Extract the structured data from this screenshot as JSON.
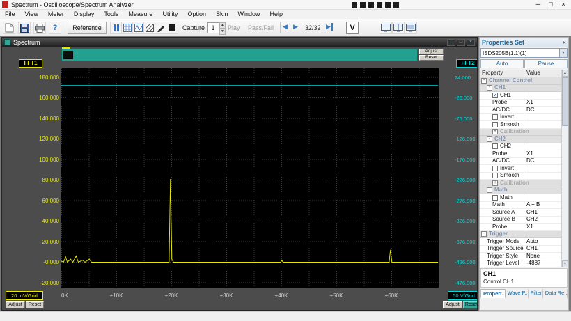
{
  "window": {
    "title": "Spectrum - Oscilloscope/Spectrum Analyzer"
  },
  "menu_items": [
    "File",
    "View",
    "Meter",
    "Display",
    "Tools",
    "Measure",
    "Utility",
    "Option",
    "Skin",
    "Window",
    "Help"
  ],
  "toolbar": {
    "reference": "Reference",
    "capture_label": "Capture",
    "capture_value": "1",
    "play": "Play",
    "pass_fail": "Pass/Fail",
    "counter": "32/32",
    "v_label": "V"
  },
  "icons": {
    "titlebar": [
      "app-icon",
      "minimize-icon",
      "maximize-icon",
      "close-icon"
    ],
    "toolbar": [
      "new-file-icon",
      "save-icon",
      "print-icon",
      "help-icon",
      "pause-icon",
      "grid-icon",
      "waveform-grid-icon",
      "hatch-icon",
      "pen-icon",
      "solid-square-icon",
      "prev-capture-icon",
      "next-capture-icon",
      "last-capture-icon",
      "v-icon",
      "display-single-icon",
      "display-dual-icon",
      "display-list-icon"
    ],
    "spectrum_window": [
      "window-icon",
      "minimize-icon",
      "restore-icon",
      "close-icon"
    ],
    "properties": [
      "close-icon",
      "dropdown-arrow-icon",
      "scroll-up-icon",
      "scroll-down-icon"
    ]
  },
  "spectrum": {
    "title": "Spectrum",
    "adjust": "Adjust",
    "reset": "Reset",
    "fft1": {
      "label": "FFT1",
      "unit": "20 mV/Grid",
      "ticks": [
        "180.000",
        "160.000",
        "140.000",
        "120.000",
        "100.000",
        "80.000",
        "60.000",
        "40.000",
        "20.000",
        "-0.000",
        "-20.000"
      ]
    },
    "fft2": {
      "label": "FFT2",
      "unit": "50 V/Grid",
      "ticks": [
        "24.000",
        "-26.000",
        "-76.000",
        "-126.000",
        "-176.000",
        "-226.000",
        "-276.000",
        "-326.000",
        "-376.000",
        "-426.000",
        "-476.000"
      ]
    },
    "x_ticks": [
      "0K",
      "+10K",
      "+20K",
      "+30K",
      "+40K",
      "+50K",
      "+60K"
    ]
  },
  "chart_data": {
    "type": "line",
    "title": "FFT Spectrum",
    "x_unit": "kHz",
    "x_range": [
      0,
      68.5
    ],
    "grid": {
      "x_step_khz": 5,
      "y_step_left": 20,
      "style": "dotted"
    },
    "left_axis": {
      "label": "FFT1",
      "ylim": [
        -20,
        180
      ],
      "unit": "20 mV/Grid",
      "color": "#e8e800"
    },
    "right_axis": {
      "label": "FFT2",
      "ylim": [
        -476,
        24
      ],
      "unit": "50 V/Grid",
      "color": "#00dcdc"
    },
    "series": [
      {
        "name": "FFT1",
        "axis": "left",
        "color": "#e8e800",
        "points": [
          [
            0,
            1
          ],
          [
            0.4,
            0
          ],
          [
            0.8,
            5
          ],
          [
            1.1,
            0
          ],
          [
            1.7,
            3
          ],
          [
            2.1,
            0
          ],
          [
            2.7,
            6
          ],
          [
            3.1,
            0
          ],
          [
            3.9,
            2
          ],
          [
            4.3,
            0
          ],
          [
            5.1,
            3
          ],
          [
            5.5,
            0
          ],
          [
            19.6,
            0
          ],
          [
            19.85,
            81
          ],
          [
            20.1,
            3
          ],
          [
            20.4,
            0
          ],
          [
            39.9,
            0
          ],
          [
            40.1,
            2
          ],
          [
            40.3,
            0
          ],
          [
            59.6,
            0
          ],
          [
            59.85,
            12
          ],
          [
            60.1,
            0
          ],
          [
            68.5,
            0
          ]
        ]
      },
      {
        "name": "FFT2",
        "axis": "right",
        "color": "#00dcdc",
        "points": [
          [
            0,
            4
          ],
          [
            68.5,
            4
          ]
        ]
      }
    ]
  },
  "properties": {
    "title": "Properties Set",
    "device": "ISDS205B(1.1)(1)",
    "auto": "Auto",
    "pause": "Pause",
    "columns": [
      "Property",
      "Value"
    ],
    "rows": [
      {
        "t": "group",
        "lv": 0,
        "label": "Channel Control",
        "exp": true
      },
      {
        "t": "group",
        "lv": 1,
        "label": "CH1",
        "exp": true
      },
      {
        "t": "check",
        "lv": 2,
        "label": "CH1",
        "checked": true
      },
      {
        "t": "prop",
        "lv": 2,
        "label": "Probe",
        "value": "X1"
      },
      {
        "t": "prop",
        "lv": 2,
        "label": "AC/DC",
        "value": "DC"
      },
      {
        "t": "check",
        "lv": 2,
        "label": "Invert",
        "checked": false
      },
      {
        "t": "check",
        "lv": 2,
        "label": "Smooth",
        "checked": false
      },
      {
        "t": "group",
        "lv": 2,
        "label": "Calibration",
        "exp": false,
        "dim": true
      },
      {
        "t": "group",
        "lv": 1,
        "label": "CH2",
        "exp": true
      },
      {
        "t": "check",
        "lv": 2,
        "label": "CH2",
        "checked": false
      },
      {
        "t": "prop",
        "lv": 2,
        "label": "Probe",
        "value": "X1"
      },
      {
        "t": "prop",
        "lv": 2,
        "label": "AC/DC",
        "value": "DC"
      },
      {
        "t": "check",
        "lv": 2,
        "label": "Invert",
        "checked": false
      },
      {
        "t": "check",
        "lv": 2,
        "label": "Smooth",
        "checked": false
      },
      {
        "t": "group",
        "lv": 2,
        "label": "Calibration",
        "exp": false,
        "dim": true
      },
      {
        "t": "group",
        "lv": 1,
        "label": "Math",
        "exp": true
      },
      {
        "t": "check",
        "lv": 2,
        "label": "Math",
        "checked": false
      },
      {
        "t": "prop",
        "lv": 2,
        "label": "Math",
        "value": "A + B"
      },
      {
        "t": "prop",
        "lv": 2,
        "label": "Source A",
        "value": "CH1"
      },
      {
        "t": "prop",
        "lv": 2,
        "label": "Source B",
        "value": "CH2"
      },
      {
        "t": "prop",
        "lv": 2,
        "label": "Probe",
        "value": "X1"
      },
      {
        "t": "group",
        "lv": 0,
        "label": "Trigger",
        "exp": true
      },
      {
        "t": "prop",
        "lv": 1,
        "label": "Trigger Mode",
        "value": "Auto"
      },
      {
        "t": "prop",
        "lv": 1,
        "label": "Trigger Source",
        "value": "CH1"
      },
      {
        "t": "prop",
        "lv": 1,
        "label": "Trigger Style",
        "value": "None"
      },
      {
        "t": "prop",
        "lv": 1,
        "label": "Trigger Level",
        "value": "-4887"
      }
    ],
    "info_title": "CH1",
    "info_desc": "Control CH1",
    "tabs": [
      {
        "label": "Propert...",
        "active": true
      },
      {
        "label": "Wave P...",
        "active": false
      },
      {
        "label": "Filter",
        "active": false
      },
      {
        "label": "Data Re...",
        "active": false
      }
    ]
  }
}
